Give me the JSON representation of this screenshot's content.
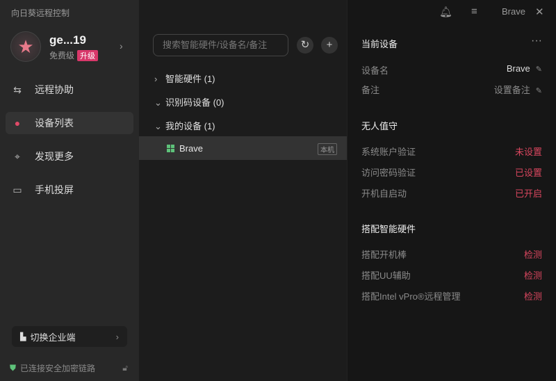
{
  "app": {
    "title": "向日葵远程控制"
  },
  "user": {
    "name": "ge...19",
    "tier": "免费级",
    "upgrade": "升级"
  },
  "nav": [
    {
      "label": "远程协助",
      "icon": "remote-assist-icon"
    },
    {
      "label": "设备列表",
      "icon": "device-list-icon"
    },
    {
      "label": "发现更多",
      "icon": "discover-icon"
    },
    {
      "label": "手机投屏",
      "icon": "screen-cast-icon"
    }
  ],
  "enterprise": {
    "label": "切换企业端"
  },
  "security": {
    "label": "已连接安全加密链路"
  },
  "search": {
    "placeholder": "搜索智能硬件/设备名/备注"
  },
  "groups": [
    {
      "label": "智能硬件 (1)",
      "expanded": false
    },
    {
      "label": "识别码设备 (0)",
      "expanded": true
    },
    {
      "label": "我的设备 (1)",
      "expanded": true
    }
  ],
  "device": {
    "name": "Brave",
    "tag": "本机"
  },
  "window": {
    "device_name": "Brave"
  },
  "details": {
    "current_title": "当前设备",
    "more": "···",
    "name_label": "设备名",
    "name_value": "Brave",
    "note_label": "备注",
    "note_value": "设置备注",
    "unattended_title": "无人值守",
    "unattended": [
      {
        "label": "系统账户验证",
        "value": "未设置"
      },
      {
        "label": "访问密码验证",
        "value": "已设置"
      },
      {
        "label": "开机自启动",
        "value": "已开启"
      }
    ],
    "hw_title": "搭配智能硬件",
    "hw": [
      {
        "label": "搭配开机棒",
        "value": "检测"
      },
      {
        "label": "搭配UU辅助",
        "value": "检测"
      },
      {
        "label": "搭配Intel vPro®远程管理",
        "value": "检测"
      }
    ]
  },
  "colors": {
    "accent": "#d8465e",
    "badge": "#d8386a",
    "shield": "#5ec27a"
  }
}
